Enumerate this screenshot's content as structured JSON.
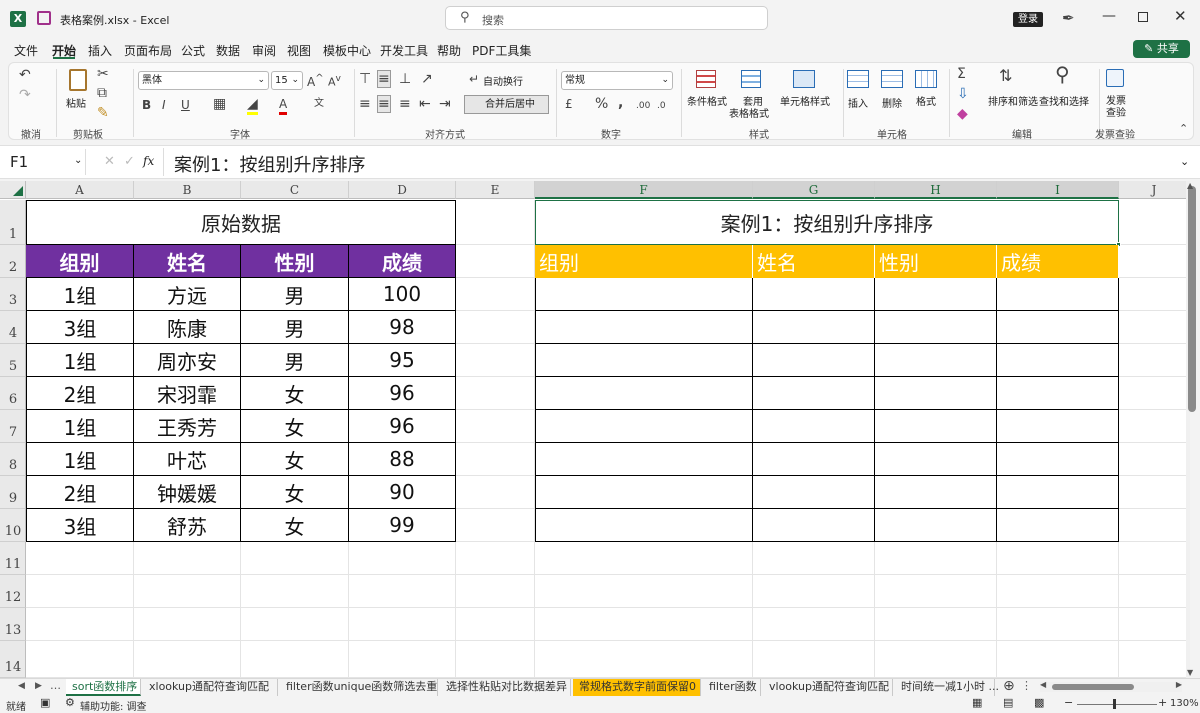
{
  "window": {
    "title": "表格案例.xlsx - Excel",
    "search_placeholder": "搜索",
    "login_label": "登录"
  },
  "menu_tabs": [
    "文件",
    "开始",
    "插入",
    "页面布局",
    "公式",
    "数据",
    "审阅",
    "视图",
    "模板中心",
    "开发工具",
    "帮助",
    "PDF工具集"
  ],
  "share_label": "共享",
  "ribbon": {
    "groups": [
      "撤消",
      "剪贴板",
      "字体",
      "对齐方式",
      "数字",
      "样式",
      "单元格",
      "编辑",
      "发票查验"
    ],
    "paste": "粘贴",
    "font_name": "黑体",
    "font_size": "15",
    "bold": "B",
    "italic": "I",
    "underline": "U",
    "wrap_text": "自动换行",
    "merge_center": "合并后居中",
    "number_format": "常规",
    "percent": "%",
    "cond_format": "条件格式",
    "table_format_1": "套用",
    "table_format_2": "表格格式",
    "cell_style": "单元格样式",
    "insert": "插入",
    "delete": "删除",
    "format": "格式",
    "sort_filter": "排序和筛选",
    "find_select": "查找和选择",
    "invoice_1": "发票",
    "invoice_2": "查验"
  },
  "formula_bar": {
    "name_box": "F1",
    "fx": "fx",
    "content": "案例1：按组别升序排序"
  },
  "columns": [
    "A",
    "B",
    "C",
    "D",
    "E",
    "F",
    "G",
    "H",
    "I",
    "J"
  ],
  "rows": [
    "1",
    "2",
    "3",
    "4",
    "5",
    "6",
    "7",
    "8",
    "9",
    "10",
    "11",
    "12",
    "13",
    "14"
  ],
  "left_table": {
    "title": "原始数据",
    "headers": [
      "组别",
      "姓名",
      "性别",
      "成绩"
    ],
    "rows": [
      [
        "1组",
        "方远",
        "男",
        "100"
      ],
      [
        "3组",
        "陈康",
        "男",
        "98"
      ],
      [
        "1组",
        "周亦安",
        "男",
        "95"
      ],
      [
        "2组",
        "宋羽霏",
        "女",
        "96"
      ],
      [
        "1组",
        "王秀芳",
        "女",
        "96"
      ],
      [
        "1组",
        "叶芯",
        "女",
        "88"
      ],
      [
        "2组",
        "钟媛媛",
        "女",
        "90"
      ],
      [
        "3组",
        "舒苏",
        "女",
        "99"
      ]
    ]
  },
  "right_table": {
    "title": "案例1：按组别升序排序",
    "headers": [
      "组别",
      "姓名",
      "性别",
      "成绩"
    ]
  },
  "sheet_tabs": [
    "sort函数排序",
    "xlookup通配符查询匹配",
    "filter函数unique函数筛选去重",
    "选择性粘贴对比数据差异",
    "常规格式数字前面保留0",
    "filter函数",
    "vlookup通配符查询匹配",
    "时间统一减1小时 ..."
  ],
  "status": {
    "ready": "就绪",
    "accessibility": "辅助功能: 调查",
    "zoom": "130%"
  },
  "colors": {
    "excel_green": "#1e7145",
    "purple_header": "#7030a0",
    "gold_header": "#ffc000",
    "orange_tab": "#ffc000"
  }
}
